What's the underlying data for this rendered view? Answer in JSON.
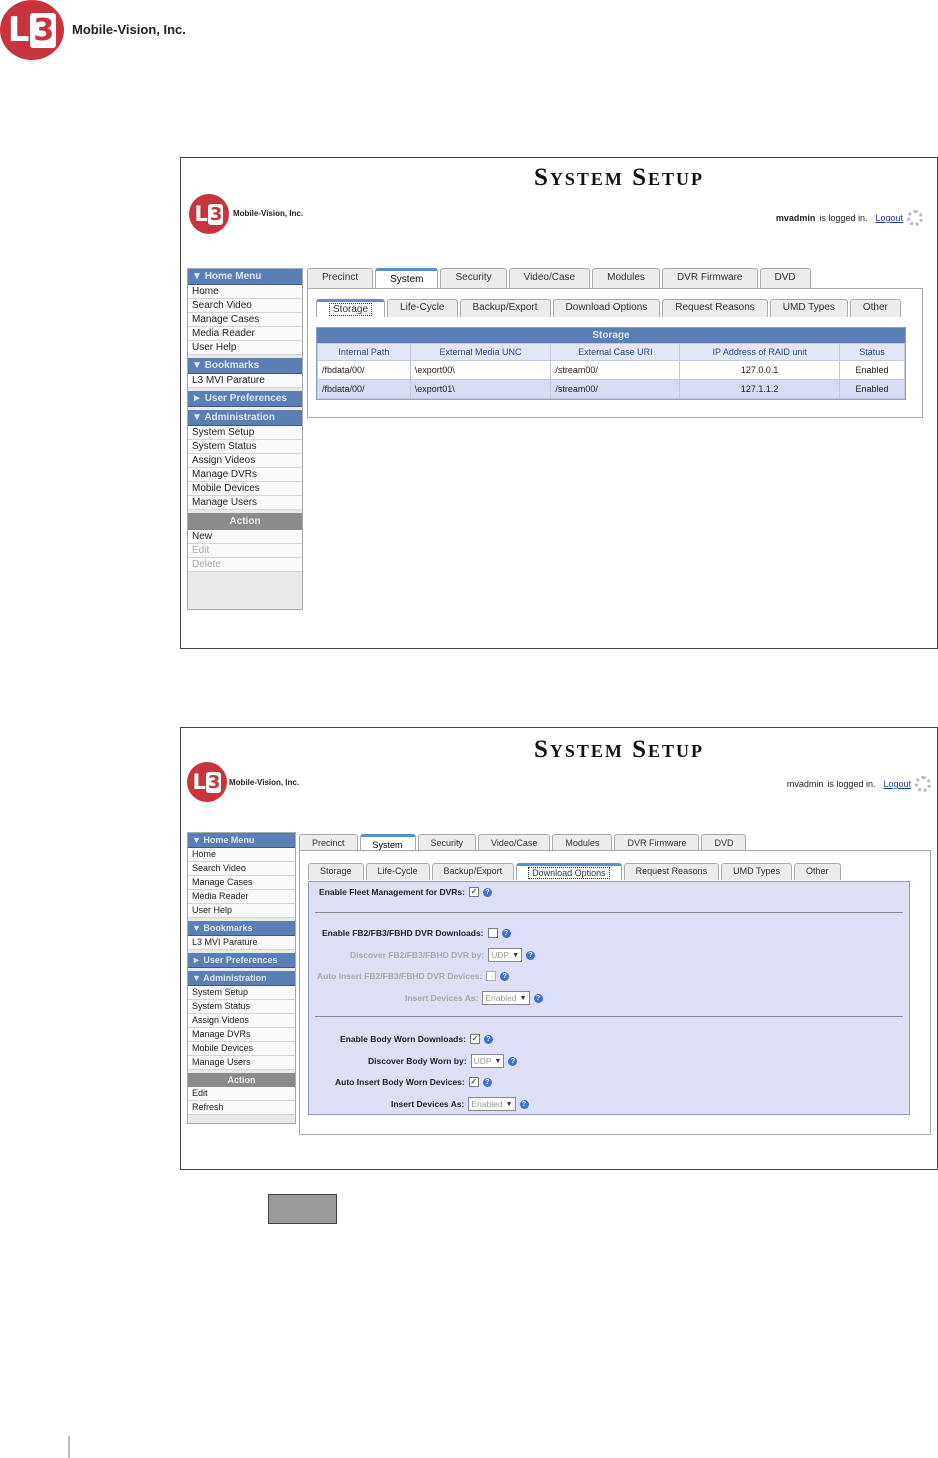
{
  "page": {
    "company": "Mobile-Vision, Inc.",
    "logo_letters": "L",
    "logo_digit": "3"
  },
  "shot1": {
    "title": "System Setup",
    "company": "Mobile-Vision, Inc.",
    "user": "mvadmin",
    "logged_in_text": "is logged in.",
    "logout": "Logout",
    "sidebar": {
      "home_menu": "Home Menu",
      "home_items": [
        "Home",
        "Search Video",
        "Manage Cases",
        "Media Reader",
        "User Help"
      ],
      "bookmarks": "Bookmarks",
      "bookmark_items": [
        "L3 MVI Parature"
      ],
      "user_prefs": "User Preferences",
      "administration": "Administration",
      "admin_items": [
        "System Setup",
        "System Status",
        "Assign Videos",
        "Manage DVRs",
        "Mobile Devices",
        "Manage Users"
      ],
      "action": "Action",
      "action_items": [
        "New",
        "Edit",
        "Delete"
      ]
    },
    "tabs": [
      "Precinct",
      "System",
      "Security",
      "Video/Case",
      "Modules",
      "DVR Firmware",
      "DVD"
    ],
    "subtabs": [
      "Storage",
      "Life-Cycle",
      "Backup/Export",
      "Download Options",
      "Request Reasons",
      "UMD Types",
      "Other"
    ],
    "storage": {
      "caption": "Storage",
      "headers": [
        "Internal Path",
        "External Media UNC",
        "External Case URI",
        "IP Address of RAID unit",
        "Status"
      ],
      "rows": [
        [
          "/fbdata/00/",
          "\\export00\\",
          "/stream00/",
          "127.0.0.1",
          "Enabled"
        ],
        [
          "/fbdata/00/",
          "\\export01\\",
          "/stream00/",
          "127.1.1.2",
          "Enabled"
        ]
      ]
    }
  },
  "shot2": {
    "title": "System Setup",
    "company": "Mobile-Vision, Inc.",
    "user": "mvadmin",
    "logged_in_text": "is logged in.",
    "logout": "Logout",
    "sidebar": {
      "home_menu": "Home Menu",
      "home_items": [
        "Home",
        "Search Video",
        "Manage Cases",
        "Media Reader",
        "User Help"
      ],
      "bookmarks": "Bookmarks",
      "bookmark_items": [
        "L3 MVI Parature"
      ],
      "user_prefs": "User Preferences",
      "administration": "Administration",
      "admin_items": [
        "System Setup",
        "System Status",
        "Assign Videos",
        "Manage DVRs",
        "Mobile Devices",
        "Manage Users"
      ],
      "action": "Action",
      "action_items": [
        "Edit",
        "Refresh"
      ]
    },
    "tabs": [
      "Precinct",
      "System",
      "Security",
      "Video/Case",
      "Modules",
      "DVR Firmware",
      "DVD"
    ],
    "subtabs": [
      "Storage",
      "Life-Cycle",
      "Backup/Export",
      "Download Options",
      "Request Reasons",
      "UMD Types",
      "Other"
    ],
    "download": {
      "fleet_label": "Enable Fleet Management for DVRs:",
      "fleet_checked": true,
      "fb_label": "Enable FB2/FB3/FBHD DVR Downloads:",
      "fb_checked": false,
      "fb_discover_label": "Discover FB2/FB3/FBHD DVR by:",
      "fb_discover_value": "UDP",
      "fb_auto_label": "Auto Insert FB2/FB3/FBHD DVR Devices:",
      "fb_insert_label": "Insert Devices As:",
      "fb_insert_value": "Enabled",
      "bw_label": "Enable Body Worn Downloads:",
      "bw_checked": true,
      "bw_discover_label": "Discover Body Worn by:",
      "bw_discover_value": "UDP",
      "bw_auto_label": "Auto Insert Body Worn Devices:",
      "bw_auto_checked": true,
      "bw_insert_label": "Insert Devices As:",
      "bw_insert_value": "Enabled"
    }
  }
}
